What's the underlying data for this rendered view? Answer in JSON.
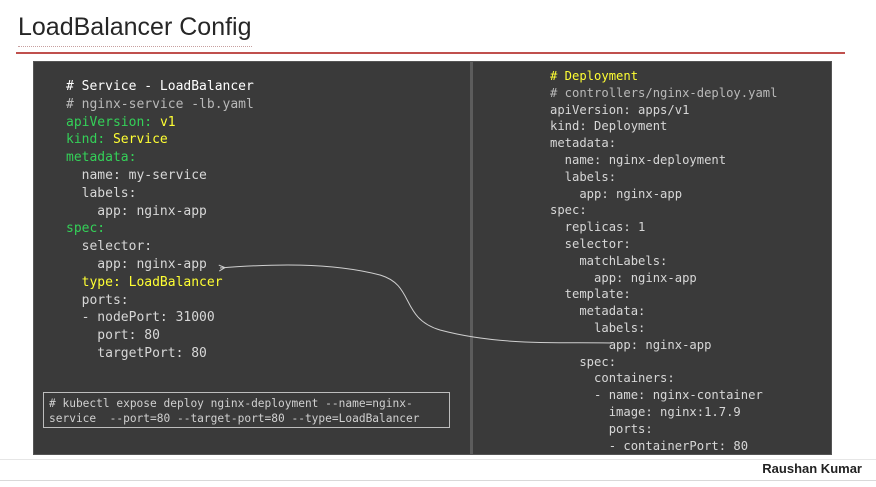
{
  "title": "LoadBalancer Config",
  "author": "Raushan Kumar",
  "colors": {
    "accent_rule": "#c0504d",
    "slide_bg": "#3a3a3a",
    "yaml_key": "#34d058",
    "yaml_value": "#ffff33",
    "comment": "#b9b9b9"
  },
  "service_yaml": {
    "header": "# Service - LoadBalancer",
    "filename": "# nginx-service -lb.yaml",
    "api_key": "apiVersion",
    "api_val": "v1",
    "kind_key": "kind",
    "kind_val": "Service",
    "metadata_key": "metadata:",
    "name_line": "  name: my-service",
    "labels_line": "  labels:",
    "app_label_line": "    app: nginx-app",
    "spec_key": "spec:",
    "selector_line": "  selector:",
    "selector_app_line": "    app: nginx-app",
    "type_line": "  type: LoadBalancer",
    "ports_line": "  ports:",
    "nodeport_line": "  - nodePort: 31000",
    "port_line": "    port: 80",
    "targetport_line": "    targetPort: 80"
  },
  "command": {
    "line1": "# kubectl expose deploy nginx-deployment --name=nginx-",
    "line2": "service  --port=80 --target-port=80 --type=LoadBalancer"
  },
  "deployment_yaml": {
    "lines": [
      "# Deployment",
      "# controllers/nginx-deploy.yaml",
      "apiVersion: apps/v1",
      "kind: Deployment",
      "metadata:",
      "  name: nginx-deployment",
      "  labels:",
      "    app: nginx-app",
      "spec:",
      "  replicas: 1",
      "  selector:",
      "    matchLabels:",
      "      app: nginx-app",
      "  template:",
      "    metadata:",
      "      labels:",
      "        app: nginx-app",
      "    spec:",
      "      containers:",
      "      - name: nginx-container",
      "        image: nginx:1.7.9",
      "        ports:",
      "        - containerPort: 80"
    ]
  },
  "connector": {
    "from": "deployment template label app: nginx-app",
    "to": "service selector app: nginx-app"
  }
}
